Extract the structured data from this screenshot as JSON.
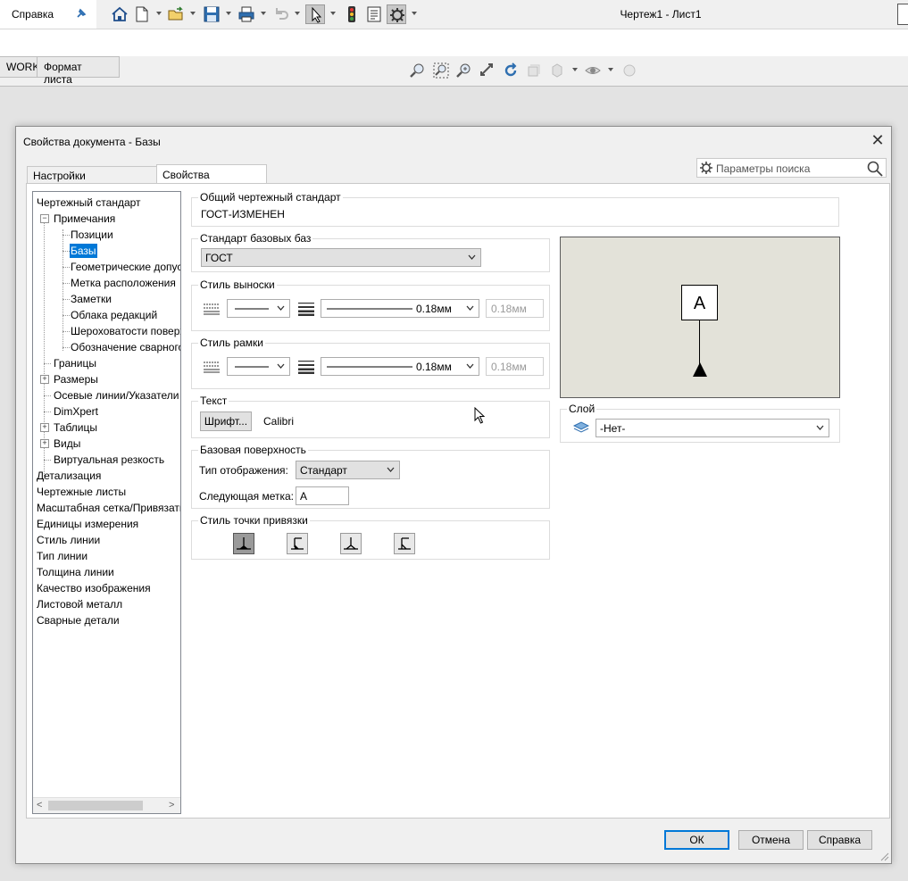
{
  "menubar": {
    "help_label": "Справка",
    "window_title": "Чертеж1 - Лист1"
  },
  "command_manager": {
    "tabs": [
      {
        "label": "WORKS"
      },
      {
        "label": "Формат листа"
      }
    ]
  },
  "dialog": {
    "title": "Свойства документа - Базы",
    "tabs": [
      {
        "label": "Настройки пользователя"
      },
      {
        "label": "Свойства документа"
      }
    ],
    "search_placeholder": "Параметры поиска",
    "tree": [
      {
        "label": "Чертежный стандарт"
      },
      {
        "label": "Примечания",
        "toggle": "−"
      },
      {
        "label": "Позиции"
      },
      {
        "label": "Базы",
        "selected": true
      },
      {
        "label": "Геометрические допус"
      },
      {
        "label": "Метка расположения"
      },
      {
        "label": "Заметки"
      },
      {
        "label": "Облака редакций"
      },
      {
        "label": "Шероховатости поверх"
      },
      {
        "label": "Обозначение сварного"
      },
      {
        "label": "Границы"
      },
      {
        "label": "Размеры",
        "toggle": "+"
      },
      {
        "label": "Осевые линии/Указатели"
      },
      {
        "label": "DimXpert"
      },
      {
        "label": "Таблицы",
        "toggle": "+"
      },
      {
        "label": "Виды",
        "toggle": "+"
      },
      {
        "label": "Виртуальная резкость"
      },
      {
        "label": "Детализация"
      },
      {
        "label": "Чертежные листы"
      },
      {
        "label": "Масштабная сетка/Привязать"
      },
      {
        "label": "Единицы измерения"
      },
      {
        "label": "Стиль линии"
      },
      {
        "label": "Тип линии"
      },
      {
        "label": "Толщина линии"
      },
      {
        "label": "Качество изображения"
      },
      {
        "label": "Листовой металл"
      },
      {
        "label": "Сварные детали"
      }
    ],
    "overall_standard": {
      "title": "Общий чертежный стандарт",
      "value": "ГОСТ-ИЗМЕНЕН"
    },
    "datum_standard": {
      "title": "Стандарт базовых баз",
      "value": "ГОСТ"
    },
    "leader_style": {
      "title": "Стиль выноски",
      "thickness": "0.18мм",
      "custom": "0.18мм"
    },
    "frame_style": {
      "title": "Стиль рамки",
      "thickness": "0.18мм",
      "custom": "0.18мм"
    },
    "text": {
      "title": "Текст",
      "font_button": "Шрифт...",
      "font_name": "Calibri"
    },
    "datum_surface": {
      "title": "Базовая поверхность",
      "display_type_label": "Тип отображения:",
      "display_type_value": "Стандарт",
      "next_label_label": "Следующая метка:",
      "next_label_value": "A"
    },
    "anchor_style": {
      "title": "Стиль точки привязки"
    },
    "preview": {
      "label": "A"
    },
    "layer": {
      "title": "Слой",
      "value": "-Нет-"
    },
    "buttons": {
      "ok": "ОК",
      "cancel": "Отмена",
      "help": "Справка"
    }
  }
}
